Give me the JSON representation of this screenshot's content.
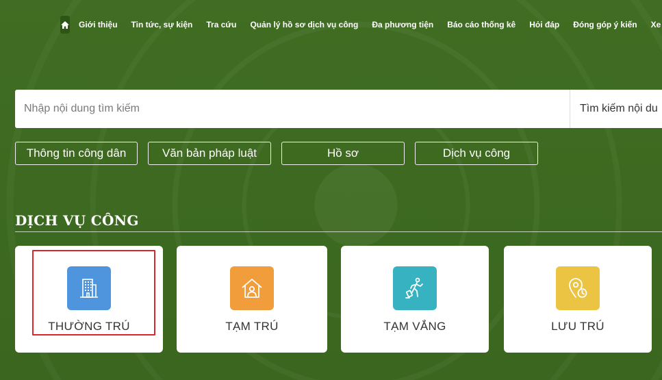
{
  "nav": {
    "items": [
      "Giới thiệu",
      "Tin tức, sự kiện",
      "Tra cứu",
      "Quản lý hồ sơ dịch vụ công",
      "Đa phương tiện",
      "Báo cáo thống kê",
      "Hỏi đáp",
      "Đóng góp ý kiến",
      "Xe"
    ]
  },
  "search": {
    "placeholder": "Nhập nội dung tìm kiếm",
    "button_label": "Tìm kiếm nội du"
  },
  "filters": [
    "Thông tin công dân",
    "Văn bản pháp luật",
    "Hồ sơ",
    "Dịch vụ công"
  ],
  "section": {
    "title": "DỊCH VỤ CÔNG"
  },
  "services": [
    {
      "label": "THƯỜNG TRÚ",
      "icon": "building-icon",
      "color": "#4f95dd",
      "selected": true
    },
    {
      "label": "TẠM TRÚ",
      "icon": "house-person-icon",
      "color": "#f19d3c",
      "selected": false
    },
    {
      "label": "TẠM VẮNG",
      "icon": "person-walking-icon",
      "color": "#36b2c0",
      "selected": false
    },
    {
      "label": "LƯU TRÚ",
      "icon": "location-clock-icon",
      "color": "#ebc443",
      "selected": false
    }
  ],
  "colors": {
    "background": "#3f6b22",
    "highlight": "#d9262b"
  }
}
